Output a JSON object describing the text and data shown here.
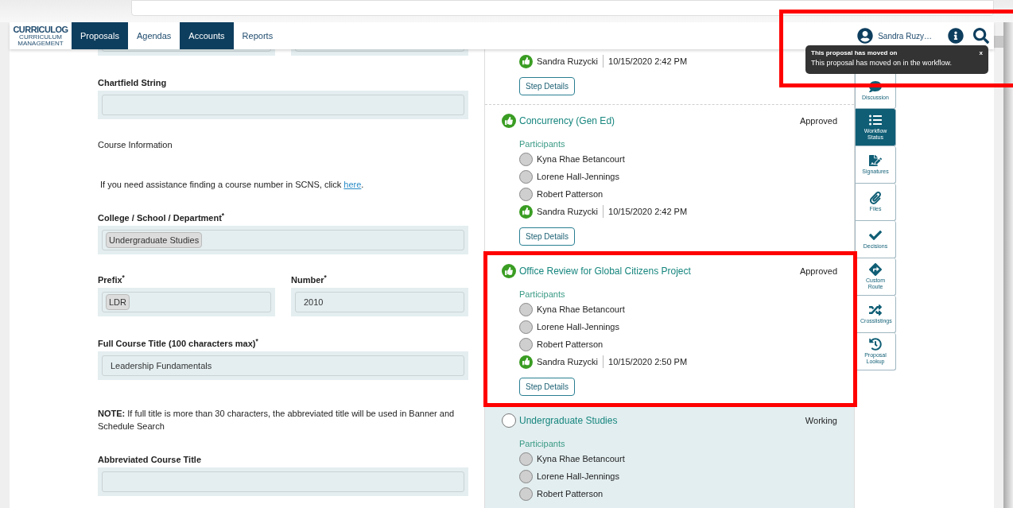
{
  "nav": {
    "logo": "CURRICULOG",
    "logo_sub": "CURRICULUM MANAGEMENT",
    "tabs": [
      {
        "label": "Proposals",
        "selected": true
      },
      {
        "label": "Agendas",
        "selected": false
      },
      {
        "label": "Accounts",
        "selected": true
      },
      {
        "label": "Reports",
        "selected": false
      }
    ],
    "user": "Sandra Ruzy…"
  },
  "toast": {
    "title": "This proposal has moved on",
    "message": "This proposal has moved on in the workflow.",
    "close": "x"
  },
  "form": [
    {
      "kind": "cut_pair"
    },
    {
      "kind": "field",
      "label": "Chartfield String"
    },
    {
      "kind": "heading",
      "text": "Course Information"
    },
    {
      "kind": "help",
      "before": "If you need assistance finding a course number in SCNS, click ",
      "link": "here",
      "after": "."
    },
    {
      "kind": "field",
      "label": "College / School / Department$^{*}$",
      "chip": "Undergraduate Studies"
    },
    {
      "kind": "pair",
      "fields": [
        {
          "label": "Prefix$^{*}$",
          "chip": "LDR"
        },
        {
          "label": "Number$^{*}$",
          "value": "2010"
        }
      ]
    },
    {
      "kind": "field",
      "label": "Full Course Title (100 characters max)$^{*}$",
      "value": "Leadership Fundamentals"
    },
    {
      "kind": "note",
      "text": "**NOTE:** If full title is more than 30 characters, the abbreviated title will be used in Banner and Schedule Search"
    },
    {
      "kind": "field",
      "label": "Abbreviated Course Title"
    }
  ],
  "workflow": [
    {
      "current": false,
      "participants": [
        {
          "name": "Sandra Ruzycki",
          "approved": true,
          "date": "10/15/2020 2:42 PM"
        }
      ],
      "button": "Step Details"
    },
    {
      "current": false,
      "title": "Concurrency (Gen Ed)",
      "approved": true,
      "status": "Approved",
      "participants_label": "Participants",
      "participants": [
        {
          "name": "Kyna Rhae Betancourt",
          "approved": false
        },
        {
          "name": "Lorene Hall-Jennings",
          "approved": false
        },
        {
          "name": "Robert Patterson",
          "approved": false
        },
        {
          "name": "Sandra Ruzycki",
          "approved": true,
          "date": "10/15/2020 2:42 PM"
        }
      ],
      "button": "Step Details"
    },
    {
      "current": false,
      "title": "Office Review for Global Citizens Project",
      "approved": true,
      "status": "Approved",
      "participants_label": "Participants",
      "participants": [
        {
          "name": "Kyna Rhae Betancourt",
          "approved": false
        },
        {
          "name": "Lorene Hall-Jennings",
          "approved": false
        },
        {
          "name": "Robert Patterson",
          "approved": false
        },
        {
          "name": "Sandra Ruzycki",
          "approved": true,
          "date": "10/15/2020 2:50 PM"
        }
      ],
      "button": "Step Details"
    },
    {
      "current": true,
      "title": "Undergraduate Studies",
      "approved": false,
      "status": "Working",
      "participants_label": "Participants",
      "participants": [
        {
          "name": "Kyna Rhae Betancourt",
          "approved": false
        },
        {
          "name": "Lorene Hall-Jennings",
          "approved": false
        },
        {
          "name": "Robert Patterson",
          "approved": false
        }
      ]
    }
  ],
  "side_tabs": [
    {
      "kind": "discussion",
      "label": "Discussion",
      "selected": false
    },
    {
      "kind": "workflow",
      "label": "Workflow Status",
      "selected": true
    },
    {
      "kind": "signatures",
      "label": "Signatures",
      "selected": false
    },
    {
      "kind": "files",
      "label": "Files",
      "selected": false
    },
    {
      "kind": "decisions",
      "label": "Decisions",
      "selected": false
    },
    {
      "kind": "route",
      "label": "Custom Route",
      "selected": false
    },
    {
      "kind": "crosslistings",
      "label": "Crosslistings",
      "selected": false
    },
    {
      "kind": "lookup",
      "label": "Proposal Lookup",
      "selected": false
    }
  ]
}
